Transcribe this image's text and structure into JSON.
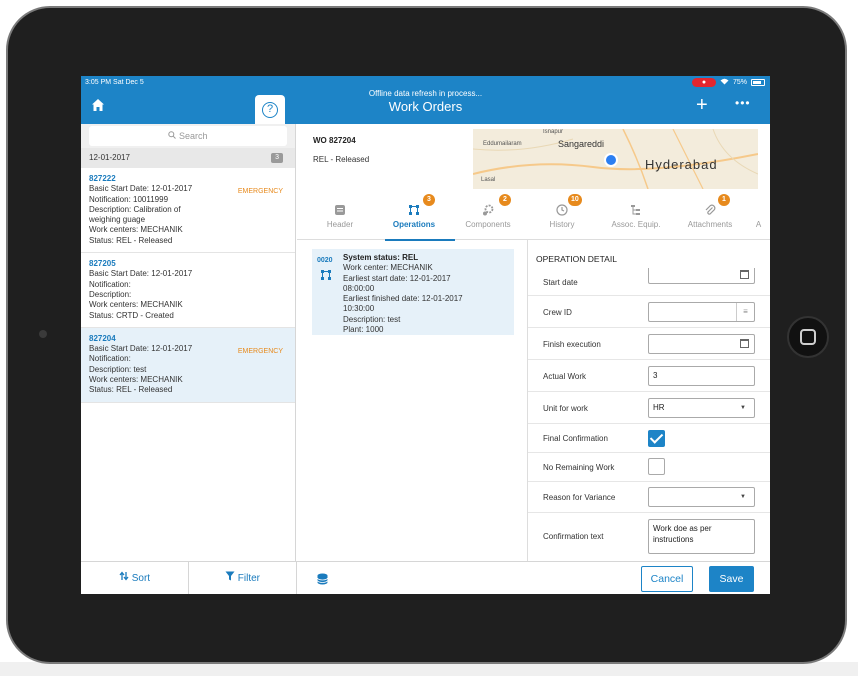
{
  "status_bar": {
    "time": "3:05 PM",
    "date": "Sat Dec 5",
    "record": "●",
    "battery": "75%"
  },
  "nav": {
    "subtitle": "Offline data refresh in process...",
    "title": "Work Orders",
    "help": "?",
    "add": "+",
    "more": "•••"
  },
  "list": {
    "search_placeholder": "Search",
    "date": "12-01-2017",
    "count": "3",
    "items": [
      {
        "id": "827222",
        "start": "Basic Start Date: 12-01-2017",
        "priority": "EMERGENCY",
        "notification": "Notification: 10011999",
        "description": "Description: Calibration of weighing guage",
        "work_centers": "Work centers: MECHANIK",
        "status": "Status: REL - Released"
      },
      {
        "id": "827205",
        "start": "Basic Start Date: 12-01-2017",
        "priority": "",
        "notification": "Notification:",
        "description": "Description:",
        "work_centers": "Work centers: MECHANIK",
        "status": "Status: CRTD - Created"
      },
      {
        "id": "827204",
        "start": "Basic Start Date: 12-01-2017",
        "priority": "EMERGENCY",
        "notification": "Notification:",
        "description": "Description: test",
        "work_centers": "Work centers: MECHANIK",
        "status": "Status: REL - Released"
      }
    ],
    "sort_label": "Sort",
    "filter_label": "Filter"
  },
  "detail": {
    "wo_title": "WO 827204",
    "wo_status": "REL - Released",
    "map": {
      "city": "Hyderabad",
      "town": "Sangareddi",
      "place1": "Eddumailaram",
      "place2": "Isnapur",
      "place3": "Lasal"
    },
    "tabs": [
      {
        "label": "Header",
        "badge": ""
      },
      {
        "label": "Operations",
        "badge": "3"
      },
      {
        "label": "Components",
        "badge": "2"
      },
      {
        "label": "History",
        "badge": "10"
      },
      {
        "label": "Assoc. Equip.",
        "badge": ""
      },
      {
        "label": "Attachments",
        "badge": "1"
      },
      {
        "label": "A",
        "badge": ""
      }
    ],
    "operation": {
      "number": "0020",
      "system_status": "System status: REL",
      "work_center": "Work center: MECHANIK",
      "earliest_start": "Earliest start date: 12-01-2017",
      "earliest_start_time": "08:00:00",
      "earliest_finish": "Earliest finished date: 12-01-2017",
      "earliest_finish_time": "10:30:00",
      "description": "Description: test",
      "plant": "Plant: 1000"
    },
    "op_detail": {
      "title": "OPERATION DETAIL",
      "start_date_label": "Start date",
      "crew_id_label": "Crew ID",
      "finish_execution_label": "Finish execution",
      "actual_work_label": "Actual Work",
      "actual_work_value": "3",
      "unit_label": "Unit for work",
      "unit_value": "HR",
      "final_confirmation_label": "Final Confirmation",
      "final_confirmation": true,
      "no_remaining_label": "No Remaining Work",
      "no_remaining": false,
      "reason_label": "Reason for Variance",
      "reason_value": "",
      "confirmation_text_label": "Confirmation text",
      "confirmation_text_value": "Work doe as per instructions"
    },
    "cancel_label": "Cancel",
    "save_label": "Save"
  },
  "colors": {
    "primary": "#1d84c7",
    "link": "#1a7bbd",
    "emergency": "#e78a1d",
    "selected": "#e6f1f9"
  },
  "icons": [
    "home-icon",
    "help-icon",
    "search-icon",
    "sort-icon",
    "filter-icon",
    "location-dot-icon",
    "header-tab-icon",
    "operations-tab-icon",
    "components-tab-icon",
    "history-tab-icon",
    "assoc-equip-tab-icon",
    "attachments-tab-icon",
    "calendar-icon",
    "list-icon",
    "checkbox-icon",
    "database-icon"
  ]
}
